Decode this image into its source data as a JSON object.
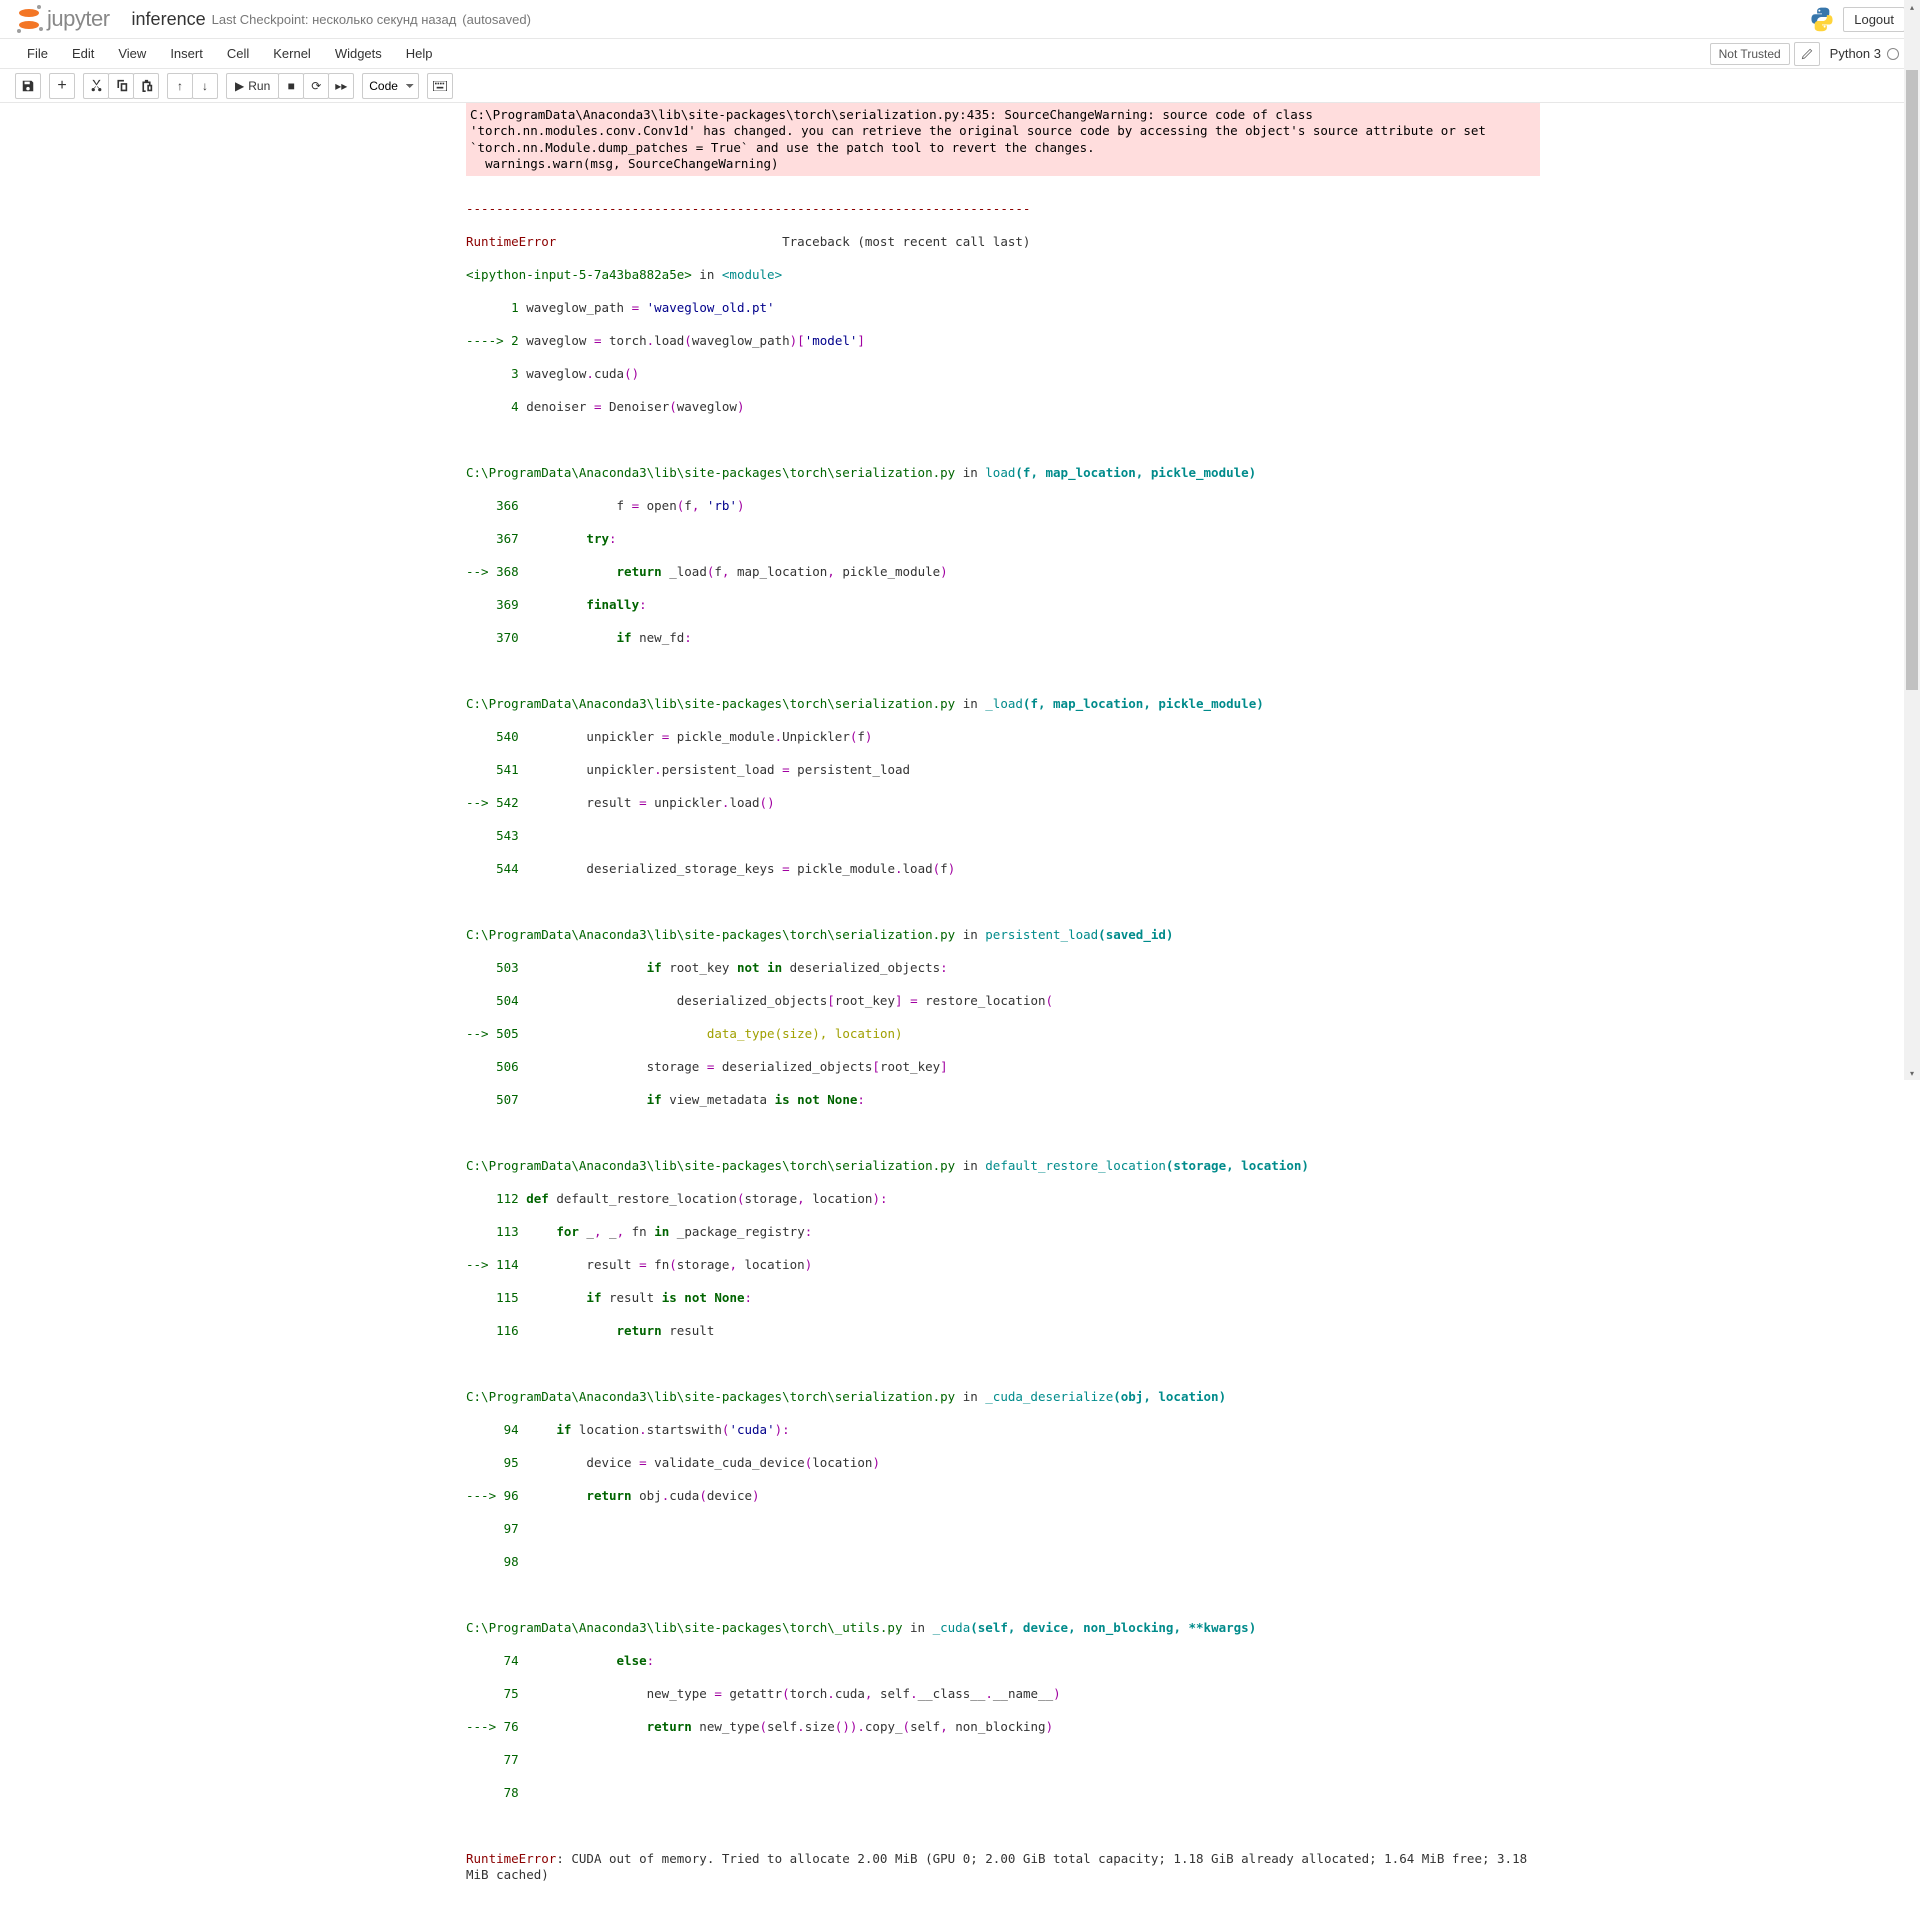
{
  "header": {
    "jupyter_text": "jupyter",
    "notebook_name": "inference",
    "checkpoint_prefix": "Last Checkpoint:",
    "checkpoint_time": "несколько секунд назад",
    "autosave": "(autosaved)",
    "logout": "Logout"
  },
  "menubar": {
    "items": [
      "File",
      "Edit",
      "View",
      "Insert",
      "Cell",
      "Kernel",
      "Widgets",
      "Help"
    ],
    "not_trusted": "Not Trusted",
    "kernel_name": "Python 3"
  },
  "toolbar": {
    "run_label": "Run",
    "celltype_selected": "Code"
  },
  "output": {
    "warning_text": "C:\\ProgramData\\Anaconda3\\lib\\site-packages\\torch\\serialization.py:435: SourceChangeWarning: source code of class 'torch.nn.modules.conv.Conv1d' has changed. you can retrieve the original source code by accessing the object's source attribute or set `torch.nn.Module.dump_patches = True` and use the patch tool to revert the changes.\n  warnings.warn(msg, SourceChangeWarning)",
    "sep": "---------------------------------------------------------------------------",
    "error_name": "RuntimeError",
    "traceback_header_tail": "                              Traceback (most recent call last)",
    "ipython_input": "<ipython-input-5-7a43ba882a5e>",
    "in_word": " in ",
    "module_word": "<module>",
    "frames": {
      "f0": {
        "l1_num": "      1",
        "l1_code_a": " waveglow_path ",
        "l1_eq": "=",
        "l1_code_b": " ",
        "l1_str": "'waveglow_old.pt'",
        "l2_arrow": "----> 2",
        "l2_code_a": " waveglow ",
        "l2_eq": "=",
        "l2_code_b": " torch",
        "l2_dot1": ".",
        "l2_code_c": "load",
        "l2_paren1": "(",
        "l2_code_d": "waveglow_path",
        "l2_paren2": ")[",
        "l2_str": "'model'",
        "l2_paren3": "]",
        "l3_num": "      3",
        "l3_code_a": " waveglow",
        "l3_dot": ".",
        "l3_code_b": "cuda",
        "l3_paren": "()",
        "l4_num": "      4",
        "l4_code_a": " denoiser ",
        "l4_eq": "=",
        "l4_code_b": " Denoiser",
        "l4_paren1": "(",
        "l4_code_c": "waveglow",
        "l4_paren2": ")"
      },
      "f1": {
        "path": "C:\\ProgramData\\Anaconda3\\lib\\site-packages\\torch\\serialization.py",
        "in": " in ",
        "fn": "load",
        "sig": "(f, map_location, pickle_module)",
        "l366_num": "    366",
        "l366_code": "             f ",
        "l366_eq": "=",
        "l366_rest": " open",
        "l366_p1": "(",
        "l366_arg": "f",
        "l366_comma": ",",
        "l366_sp": " ",
        "l366_str": "'rb'",
        "l366_p2": ")",
        "l367_num": "    367",
        "l367_pad": "         ",
        "l367_kw": "try",
        "l367_colon": ":",
        "l368_arrow": "--> 368",
        "l368_pad": "             ",
        "l368_kw": "return",
        "l368_rest": " _load",
        "l368_p1": "(",
        "l368_args": "f",
        "l368_c1": ",",
        "l368_a2": " map_location",
        "l368_c2": ",",
        "l368_a3": " pickle_module",
        "l368_p2": ")",
        "l369_num": "    369",
        "l369_pad": "         ",
        "l369_kw": "finally",
        "l369_colon": ":",
        "l370_num": "    370",
        "l370_pad": "             ",
        "l370_kw": "if",
        "l370_rest": " new_fd",
        "l370_colon": ":"
      },
      "f2": {
        "path": "C:\\ProgramData\\Anaconda3\\lib\\site-packages\\torch\\serialization.py",
        "in": " in ",
        "fn": "_load",
        "sig": "(f, map_location, pickle_module)",
        "l540_num": "    540",
        "l540_code": "         unpickler ",
        "l540_eq": "=",
        "l540_rest": " pickle_module",
        "l540_dot": ".",
        "l540_m": "Unpickler",
        "l540_p1": "(",
        "l540_arg": "f",
        "l540_p2": ")",
        "l541_num": "    541",
        "l541_code": "         unpickler",
        "l541_dot": ".",
        "l541_attr": "persistent_load ",
        "l541_eq": "=",
        "l541_rest": " persistent_load",
        "l542_arrow": "--> 542",
        "l542_code": "         result ",
        "l542_eq": "=",
        "l542_rest": " unpickler",
        "l542_dot": ".",
        "l542_m": "load",
        "l542_p": "()",
        "l543_num": "    543",
        "l543_code": "",
        "l544_num": "    544",
        "l544_code": "         deserialized_storage_keys ",
        "l544_eq": "=",
        "l544_rest": " pickle_module",
        "l544_dot": ".",
        "l544_m": "load",
        "l544_p1": "(",
        "l544_arg": "f",
        "l544_p2": ")"
      },
      "f3": {
        "path": "C:\\ProgramData\\Anaconda3\\lib\\site-packages\\torch\\serialization.py",
        "in": " in ",
        "fn": "persistent_load",
        "sig": "(saved_id)",
        "l503_num": "    503",
        "l503_pad": "                 ",
        "l503_kw": "if",
        "l503_rest": " root_key ",
        "l503_kw2": "not",
        "l503_sp": " ",
        "l503_kw3": "in",
        "l503_rest2": " deserialized_objects",
        "l503_colon": ":",
        "l504_num": "    504",
        "l504_code": "                     deserialized_objects",
        "l504_b1": "[",
        "l504_k": "root_key",
        "l504_b2": "]",
        "l504_sp": " ",
        "l504_eq": "=",
        "l504_rest": " restore_location",
        "l504_p1": "(",
        "l505_arrow": "--> 505",
        "l505_pad": "                         ",
        "l505_a1": "data_type",
        "l505_p1": "(",
        "l505_a2": "size",
        "l505_p2": "),",
        "l505_sp": " ",
        "l505_a3": "location",
        "l505_p3": ")",
        "l506_num": "    506",
        "l506_code": "                 storage ",
        "l506_eq": "=",
        "l506_rest": " deserialized_objects",
        "l506_b1": "[",
        "l506_k": "root_key",
        "l506_b2": "]",
        "l507_num": "    507",
        "l507_pad": "                 ",
        "l507_kw": "if",
        "l507_rest": " view_metadata ",
        "l507_kw2": "is",
        "l507_sp": " ",
        "l507_kw3": "not",
        "l507_sp2": " ",
        "l507_none": "None",
        "l507_colon": ":"
      },
      "f4": {
        "path": "C:\\ProgramData\\Anaconda3\\lib\\site-packages\\torch\\serialization.py",
        "in": " in ",
        "fn": "default_restore_location",
        "sig": "(storage, location)",
        "l112_num": "    112",
        "l112_sp": " ",
        "l112_kw": "def",
        "l112_rest": " default_restore_location",
        "l112_p1": "(",
        "l112_a1": "storage",
        "l112_c": ",",
        "l112_a2": " location",
        "l112_p2": "):",
        "l113_num": "    113",
        "l113_pad": "     ",
        "l113_kw": "for",
        "l113_rest": " _",
        "l113_c1": ",",
        "l113_a2": " _",
        "l113_c2": ",",
        "l113_a3": " fn ",
        "l113_kw2": "in",
        "l113_rest2": " _package_registry",
        "l113_colon": ":",
        "l114_arrow": "--> 114",
        "l114_code": "         result ",
        "l114_eq": "=",
        "l114_rest": " fn",
        "l114_p1": "(",
        "l114_a1": "storage",
        "l114_c": ",",
        "l114_a2": " location",
        "l114_p2": ")",
        "l115_num": "    115",
        "l115_pad": "         ",
        "l115_kw": "if",
        "l115_rest": " result ",
        "l115_kw2": "is",
        "l115_sp": " ",
        "l115_kw3": "not",
        "l115_sp2": " ",
        "l115_none": "None",
        "l115_colon": ":",
        "l116_num": "    116",
        "l116_pad": "             ",
        "l116_kw": "return",
        "l116_rest": " result"
      },
      "f5": {
        "path": "C:\\ProgramData\\Anaconda3\\lib\\site-packages\\torch\\serialization.py",
        "in": " in ",
        "fn": "_cuda_deserialize",
        "sig": "(obj, location)",
        "l94_num": "     94",
        "l94_pad": "     ",
        "l94_kw": "if",
        "l94_rest": " location",
        "l94_dot": ".",
        "l94_m": "startswith",
        "l94_p1": "(",
        "l94_str": "'cuda'",
        "l94_p2": "):",
        "l95_num": "     95",
        "l95_code": "         device ",
        "l95_eq": "=",
        "l95_rest": " validate_cuda_device",
        "l95_p1": "(",
        "l95_arg": "location",
        "l95_p2": ")",
        "l96_arrow": "---> 96",
        "l96_pad": "         ",
        "l96_kw": "return",
        "l96_rest": " obj",
        "l96_dot": ".",
        "l96_m": "cuda",
        "l96_p1": "(",
        "l96_arg": "device",
        "l96_p2": ")",
        "l97_num": "     97",
        "l97_code": "",
        "l98_num": "     98",
        "l98_code": ""
      },
      "f6": {
        "path": "C:\\ProgramData\\Anaconda3\\lib\\site-packages\\torch\\_utils.py",
        "in": " in ",
        "fn": "_cuda",
        "sig": "(self, device, non_blocking, **kwargs)",
        "l74_num": "     74",
        "l74_pad": "             ",
        "l74_kw": "else",
        "l74_colon": ":",
        "l75_num": "     75",
        "l75_code": "                 new_type ",
        "l75_eq": "=",
        "l75_rest": " getattr",
        "l75_p1": "(",
        "l75_a1": "torch",
        "l75_dot1": ".",
        "l75_a2": "cuda",
        "l75_c1": ",",
        "l75_a3": " self",
        "l75_dot2": ".",
        "l75_a4": "__class__",
        "l75_dot3": ".",
        "l75_a5": "__name__",
        "l75_p2": ")",
        "l76_arrow": "---> 76",
        "l76_pad": "                 ",
        "l76_kw": "return",
        "l76_rest": " new_type",
        "l76_p1": "(",
        "l76_a1": "self",
        "l76_dot1": ".",
        "l76_m1": "size",
        "l76_pp": "()).",
        "l76_m2": "copy_",
        "l76_p2": "(",
        "l76_a2": "self",
        "l76_c": ",",
        "l76_a3": " non_blocking",
        "l76_p3": ")",
        "l77_num": "     77",
        "l77_code": "",
        "l78_num": "     78",
        "l78_code": ""
      }
    },
    "final_error_name": "RuntimeError",
    "final_error_colon": ": ",
    "final_error_msg": "CUDA out of memory. Tried to allocate 2.00 MiB (GPU 0; 2.00 GiB total capacity; 1.18 GiB already allocated; 1.64 MiB free; 3.18 MiB cached)"
  }
}
